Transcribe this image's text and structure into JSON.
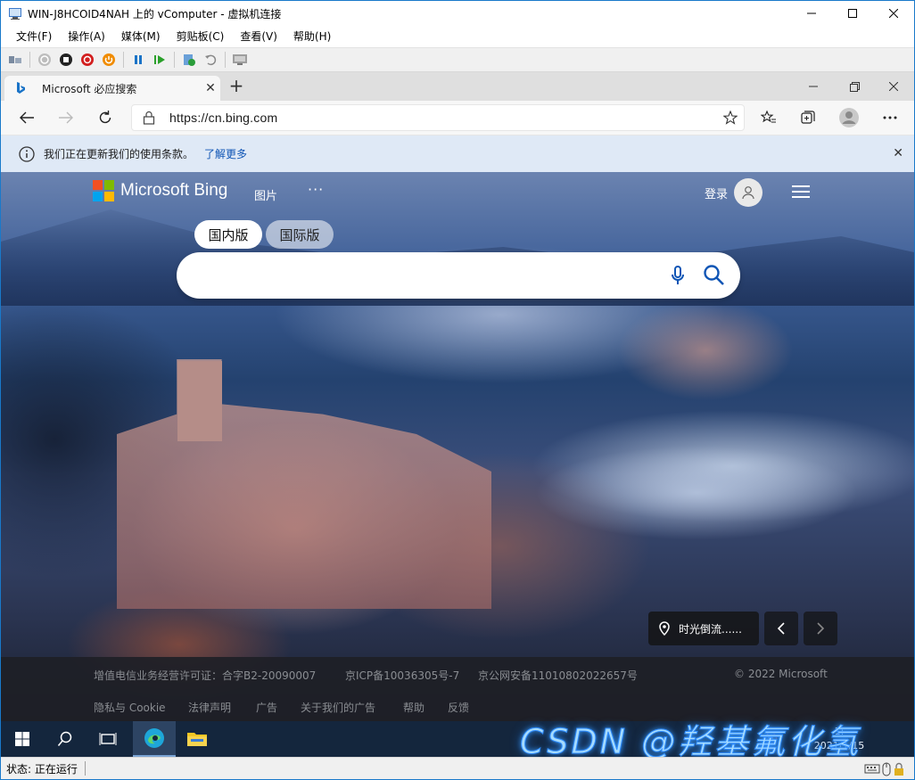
{
  "vm_window": {
    "title": "WIN-J8HCOID4NAH 上的 vComputer - 虚拟机连接",
    "menu": [
      "文件(F)",
      "操作(A)",
      "媒体(M)",
      "剪贴板(C)",
      "查看(V)",
      "帮助(H)"
    ],
    "toolbar_icons": [
      "ctrl-alt-del-icon",
      "start-icon",
      "turn-off-icon",
      "shutdown-icon",
      "power-icon",
      "pause-icon",
      "resume-icon",
      "checkpoint-icon",
      "revert-icon",
      "enhanced-session-icon"
    ]
  },
  "browser": {
    "tab_title": "Microsoft 必应搜索",
    "url": "https://cn.bing.com",
    "infobar_text": "我们正在更新我们的使用条款。",
    "infobar_link": "了解更多"
  },
  "bing": {
    "brand": "Microsoft Bing",
    "nav_images": "图片",
    "nav_more": "···",
    "login": "登录",
    "scope_cn": "国内版",
    "scope_intl": "国际版",
    "image_title": "时光倒流......",
    "footer": {
      "license": "增值电信业务经营许可证：合字B2-20090007",
      "icp": "京ICP备10036305号-7",
      "police": "京公网安备11010802022657号",
      "copyright": "© 2022 Microsoft",
      "links": [
        "隐私与 Cookie",
        "法律声明",
        "广告",
        "关于我们的广告",
        "帮助",
        "反馈"
      ]
    },
    "colors": {
      "ms_red": "#f25022",
      "ms_green": "#7fba00",
      "ms_blue": "#00a4ef",
      "ms_yellow": "#ffb900",
      "accent": "#0f55b5"
    }
  },
  "taskbar": {
    "date": "2021/1/15",
    "time": "1:"
  },
  "watermark": "CSDN @羟基氟化氢",
  "status": "状态: 正在运行"
}
